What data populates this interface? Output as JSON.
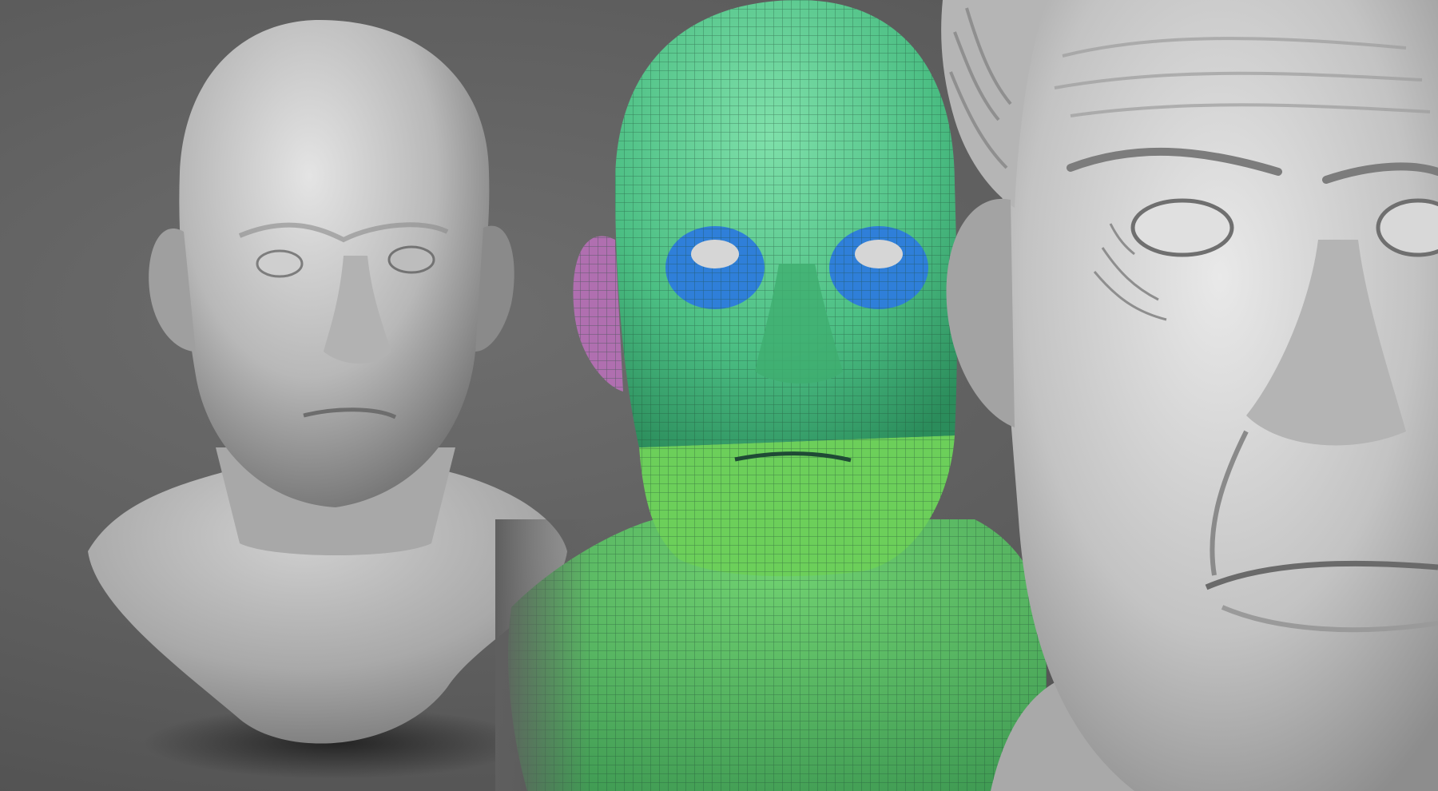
{
  "scene": {
    "background_color": "#5f5f5f",
    "panels": [
      {
        "name": "smooth-sculpt-bust",
        "material": "matte-gray-clay",
        "color": "#bdbdbd"
      },
      {
        "name": "polygroup-wireframe-bust",
        "material": "wireframe",
        "color": "#3fbf7f",
        "polygroup_colors": {
          "head": "#52c48a",
          "eye-rings": "#2f7fd9",
          "ear": "#b06fb0",
          "lower-face": "#6ccf5a",
          "neck": "#55c47f"
        }
      },
      {
        "name": "detailed-sculpt-closeup",
        "material": "matte-gray-clay",
        "color": "#c8c8c8"
      }
    ]
  }
}
